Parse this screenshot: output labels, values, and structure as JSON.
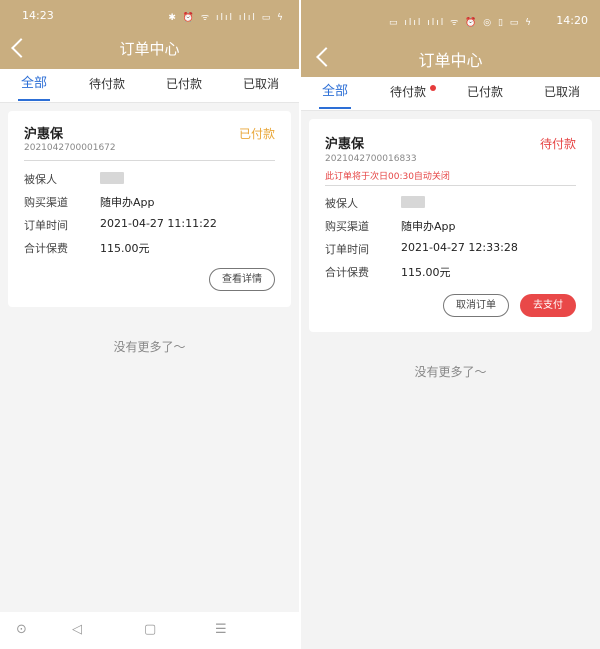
{
  "left": {
    "status_time": "14:23",
    "status_icons": "✱ ⏰ ᯤ ılıl ılıl ▭ ϟ",
    "title": "订单中心",
    "tabs": [
      {
        "label": "全部",
        "active": true
      },
      {
        "label": "待付款",
        "active": false
      },
      {
        "label": "已付款",
        "active": false
      },
      {
        "label": "已取消",
        "active": false
      }
    ],
    "order": {
      "product": "沪惠保",
      "order_no": "2021042700001672",
      "status": "已付款",
      "fields": [
        {
          "label": "被保人",
          "value": ""
        },
        {
          "label": "购买渠道",
          "value": "随申办App"
        },
        {
          "label": "订单时间",
          "value": "2021-04-27 11:11:22"
        },
        {
          "label": "合计保费",
          "value": "115.00元"
        }
      ],
      "detail_button": "查看详情"
    },
    "no_more": "没有更多了～",
    "nav_icons": [
      "circle-icon",
      "back-triangle-icon",
      "home-square-icon",
      "menu-icon"
    ]
  },
  "right": {
    "status_time": "14:20",
    "status_icons": "▭ ılıl ılıl ᯤ ⏰ ◎ ▯ ▭ ϟ",
    "title": "订单中心",
    "tabs": [
      {
        "label": "全部",
        "active": true
      },
      {
        "label": "待付款",
        "active": false,
        "dot": true
      },
      {
        "label": "已付款",
        "active": false
      },
      {
        "label": "已取消",
        "active": false
      }
    ],
    "order": {
      "product": "沪惠保",
      "order_no": "2021042700016833",
      "notice": "此订单将于次日00:30自动关闭",
      "status": "待付款",
      "fields": [
        {
          "label": "被保人",
          "value": ""
        },
        {
          "label": "购买渠道",
          "value": "随申办App"
        },
        {
          "label": "订单时间",
          "value": "2021-04-27 12:33:28"
        },
        {
          "label": "合计保费",
          "value": "115.00元"
        }
      ],
      "cancel_button": "取消订单",
      "pay_button": "去支付"
    },
    "no_more": "没有更多了～"
  },
  "colors": {
    "header": "#c9ae80",
    "tab_active": "#2d6fd6",
    "paid_status": "#e9a73a",
    "pending_status": "#e64545",
    "pay_button": "#e94848"
  }
}
